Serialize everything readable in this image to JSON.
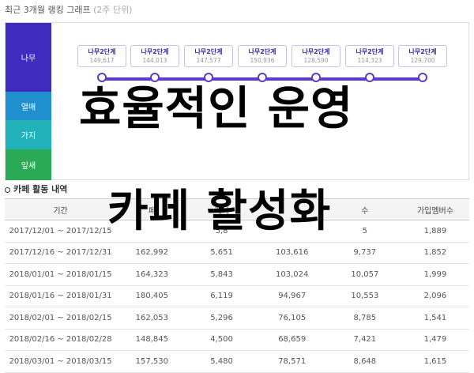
{
  "ranking": {
    "title": "최근 3개월 랭킹 그래프",
    "subtitle": "(2주 단위)",
    "tiers": [
      "나무",
      "열매",
      "가지",
      "잎새"
    ],
    "points": [
      {
        "level": "나무2단계",
        "count": "149,617"
      },
      {
        "level": "나무2단계",
        "count": "144,013"
      },
      {
        "level": "나무2단계",
        "count": "147,577"
      },
      {
        "level": "나무2단계",
        "count": "150,936"
      },
      {
        "level": "나무2단계",
        "count": "128,590"
      },
      {
        "level": "나무2단계",
        "count": "114,323"
      },
      {
        "level": "나무2단계",
        "count": "129,700"
      }
    ]
  },
  "overlay": {
    "line1": "효율적인 운영",
    "line2": "카페 활성화"
  },
  "activity": {
    "title": "카페 활동 내역",
    "headers": [
      "기간",
      "페",
      "게시",
      "",
      "수",
      "가입멤버수"
    ],
    "rows": [
      [
        "2017/12/01 ~ 2017/12/15",
        "",
        "5,8",
        "",
        "5",
        "1,889"
      ],
      [
        "2017/12/16 ~ 2017/12/31",
        "162,992",
        "5,651",
        "103,616",
        "9,737",
        "1,852"
      ],
      [
        "2018/01/01 ~ 2018/01/15",
        "164,323",
        "5,843",
        "103,024",
        "10,057",
        "1,999"
      ],
      [
        "2018/01/16 ~ 2018/01/31",
        "180,405",
        "6,119",
        "94,967",
        "10,553",
        "2,096"
      ],
      [
        "2018/02/01 ~ 2018/02/15",
        "162,053",
        "5,296",
        "76,105",
        "8,785",
        "1,541"
      ],
      [
        "2018/02/16 ~ 2018/02/28",
        "148,845",
        "4,500",
        "68,659",
        "7,421",
        "1,479"
      ],
      [
        "2018/03/01 ~ 2018/03/15",
        "157,530",
        "5,480",
        "78,571",
        "8,648",
        "1,615"
      ]
    ]
  }
}
